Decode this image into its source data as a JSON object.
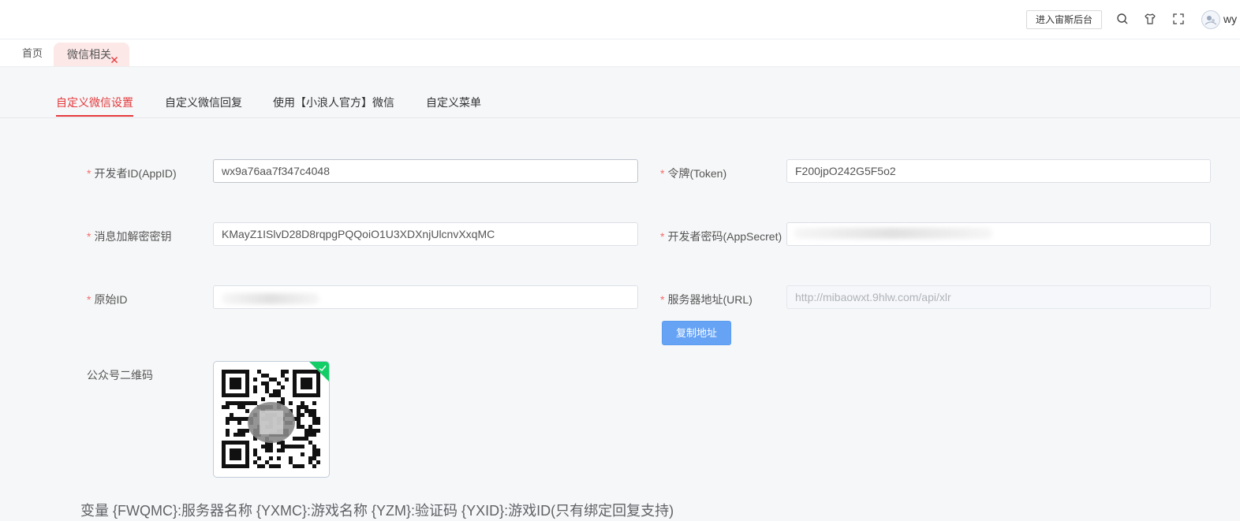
{
  "header": {
    "enter_backend_label": "进入宙斯后台",
    "icons": [
      "search-icon",
      "tshirt-icon",
      "fullscreen-icon"
    ],
    "username": "wy"
  },
  "tags": {
    "home_label": "首页",
    "active_label": "微信相关"
  },
  "subtabs": [
    {
      "label": "自定义微信设置",
      "active": true
    },
    {
      "label": "自定义微信回复",
      "active": false
    },
    {
      "label": "使用【小浪人官方】微信",
      "active": false
    },
    {
      "label": "自定义菜单",
      "active": false
    }
  ],
  "form": {
    "required_mark": "*",
    "appid": {
      "label": "开发者ID(AppID)",
      "value": "wx9a76aa7f347c4048"
    },
    "token": {
      "label": "令牌(Token)",
      "value": "F200jpO242G5F5o2"
    },
    "aes_key": {
      "label": "消息加解密密钥",
      "value": "KMayZ1ISlvD28D8rqpgPQQoiO1U3XDXnjUlcnvXxqMC"
    },
    "app_secret": {
      "label": "开发者密码(AppSecret)",
      "value": ""
    },
    "original_id": {
      "label": "原始ID",
      "value": ""
    },
    "server_url": {
      "label": "服务器地址(URL)",
      "value": "http://mibaowxt.9hlw.com/api/xlr"
    },
    "copy_button_label": "复制地址",
    "qr_label": "公众号二维码"
  },
  "variables_text": "变量 {FWQMC}:服务器名称 {YXMC}:游戏名称 {YZM}:验证码 {YXID}:游戏ID(只有绑定回复支持)",
  "colors": {
    "accent": "#e4393c",
    "primary_button": "#66a3f5",
    "success_corner": "#13ce66"
  }
}
